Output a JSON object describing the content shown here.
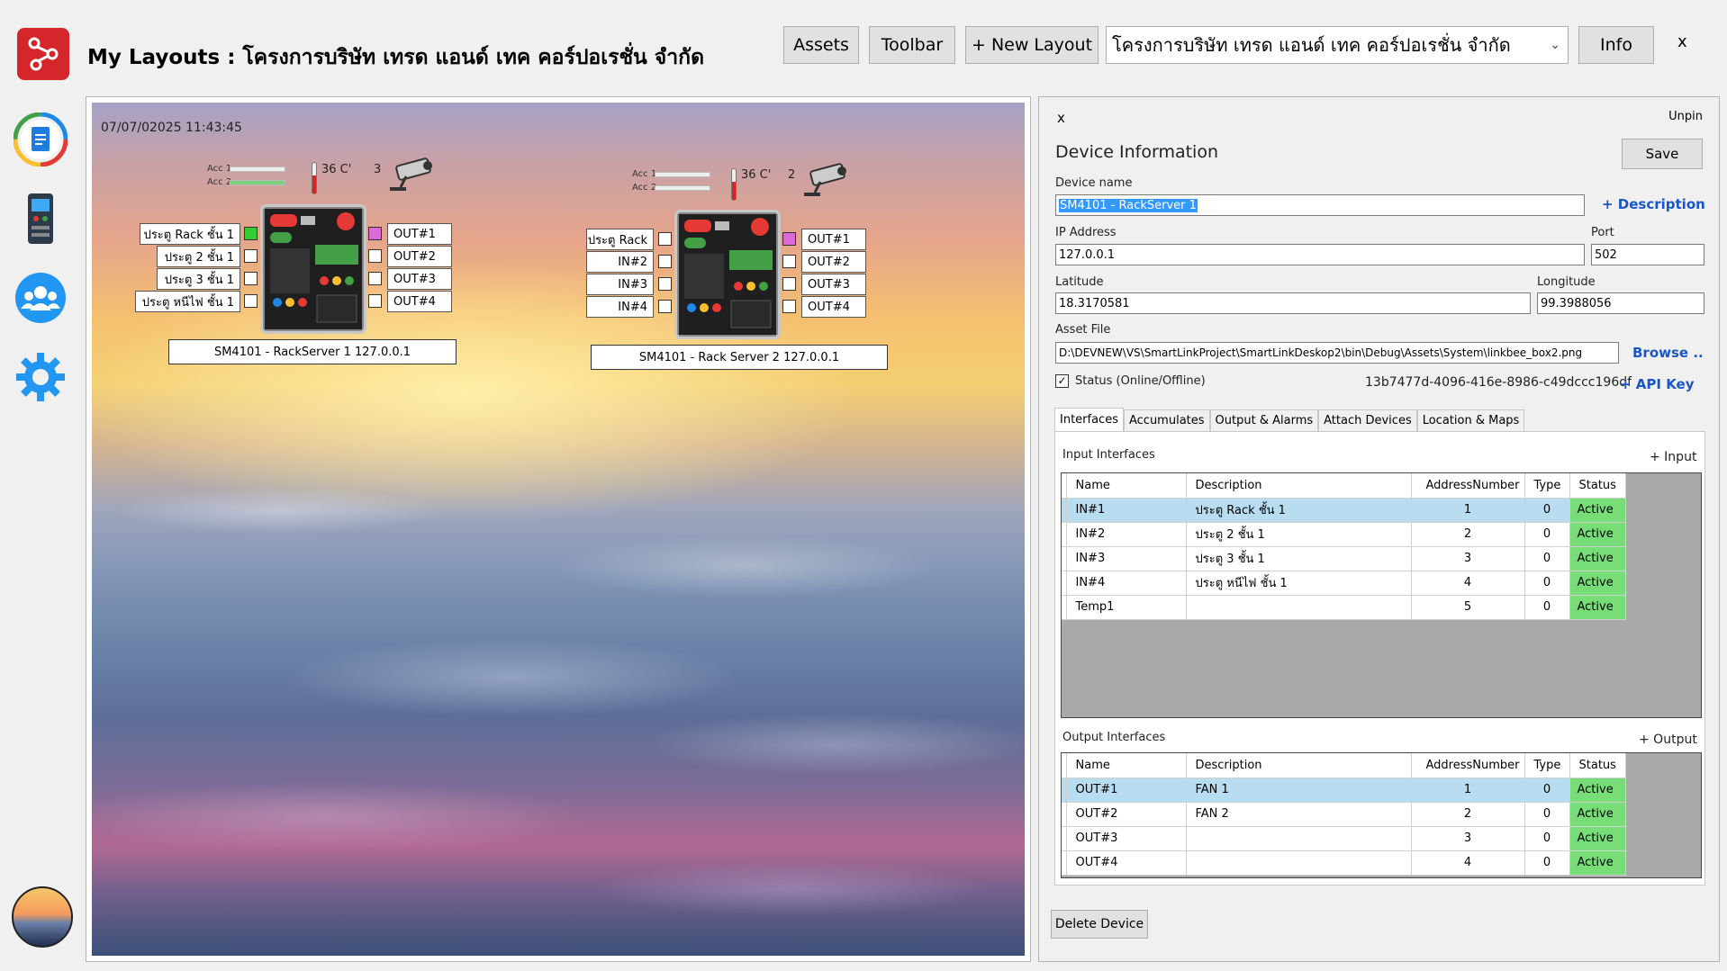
{
  "header": {
    "title": "My Layouts : โครงการบริษัท เทรด แอนด์ เทค คอร์ปอเรชั่น จำกัด",
    "assets_label": "Assets",
    "toolbar_label": "Toolbar",
    "new_layout_label": "+ New Layout",
    "layout_select_value": "โครงการบริษัท เทรด แอนด์ เทค คอร์ปอเรชั่น จำกัด",
    "info_label": "Info",
    "close_label": "x"
  },
  "sidebar": {
    "items": [
      {
        "icon": "document-icon"
      },
      {
        "icon": "device-icon"
      },
      {
        "icon": "users-icon"
      },
      {
        "icon": "gear-icon"
      },
      {
        "icon": "background-image-icon"
      }
    ]
  },
  "canvas": {
    "timestamp": "07/07/02025 11:43:45",
    "devices": [
      {
        "acc1": "Acc 1",
        "acc2": "Acc 2",
        "temp": "36 C'",
        "cam_count": "3",
        "inputs": [
          "ประตู Rack ชั้น 1",
          "ประตู 2 ชั้น 1",
          "ประตู 3 ชั้น 1",
          "ประตู หนีไฟ ชั้น 1"
        ],
        "outputs": [
          "OUT#1",
          "OUT#2",
          "OUT#3",
          "OUT#4"
        ],
        "name": "SM4101 - RackServer 1 127.0.0.1"
      },
      {
        "acc1": "Acc 1",
        "acc2": "Acc 2",
        "temp": "36 C'",
        "cam_count": "2",
        "inputs": [
          "ประตู Rack",
          "IN#2",
          "IN#3",
          "IN#4"
        ],
        "outputs": [
          "OUT#1",
          "OUT#2",
          "OUT#3",
          "OUT#4"
        ],
        "name": "SM4101 - Rack Server 2 127.0.0.1"
      }
    ]
  },
  "panel": {
    "close_label": "x",
    "unpin_label": "Unpin",
    "heading": "Device Information",
    "save_label": "Save",
    "device_name_label": "Device name",
    "device_name_value": "SM4101 - RackServer 1",
    "description_link": "+ Description",
    "ip_label": "IP Address",
    "ip_value": "127.0.0.1",
    "port_label": "Port",
    "port_value": "502",
    "latitude_label": "Latitude",
    "latitude_value": "18.3170581",
    "longitude_label": "Longitude",
    "longitude_value": "99.3988056",
    "asset_file_label": "Asset File",
    "asset_file_value": "D:\\DEVNEW\\VS\\SmartLinkProject\\SmartLinkDeskop2\\bin\\Debug\\Assets\\System\\linkbee_box2.png",
    "browse_link": "Browse ..",
    "status_label": "Status (Online/Offline)",
    "status_checked": true,
    "api_key_value": "13b7477d-4096-416e-8986-c49dccc196df",
    "api_key_link": "+ API Key",
    "tabs": [
      "Interfaces",
      "Accumulates",
      "Output & Alarms",
      "Attach Devices",
      "Location & Maps"
    ],
    "active_tab": "Interfaces",
    "input_title": "Input Interfaces",
    "add_input": "+ Input",
    "output_title": "Output Interfaces",
    "add_output": "+ Output",
    "columns": [
      "Name",
      "Description",
      "AddressNumber",
      "Type",
      "Status"
    ],
    "inputs": [
      {
        "name": "IN#1",
        "description": "ประตู Rack ชั้น 1",
        "address": "1",
        "type": "0",
        "status": "Active"
      },
      {
        "name": "IN#2",
        "description": "ประตู 2 ชั้น 1",
        "address": "2",
        "type": "0",
        "status": "Active"
      },
      {
        "name": "IN#3",
        "description": "ประตู 3 ชั้น 1",
        "address": "3",
        "type": "0",
        "status": "Active"
      },
      {
        "name": "IN#4",
        "description": "ประตู หนีไฟ ชั้น 1",
        "address": "4",
        "type": "0",
        "status": "Active"
      },
      {
        "name": "Temp1",
        "description": "",
        "address": "5",
        "type": "0",
        "status": "Active"
      }
    ],
    "outputs": [
      {
        "name": "OUT#1",
        "description": "FAN 1",
        "address": "1",
        "type": "0",
        "status": "Active"
      },
      {
        "name": "OUT#2",
        "description": "FAN 2",
        "address": "2",
        "type": "0",
        "status": "Active"
      },
      {
        "name": "OUT#3",
        "description": "",
        "address": "3",
        "type": "0",
        "status": "Active"
      },
      {
        "name": "OUT#4",
        "description": "",
        "address": "4",
        "type": "0",
        "status": "Active"
      }
    ],
    "delete_label": "Delete Device"
  }
}
